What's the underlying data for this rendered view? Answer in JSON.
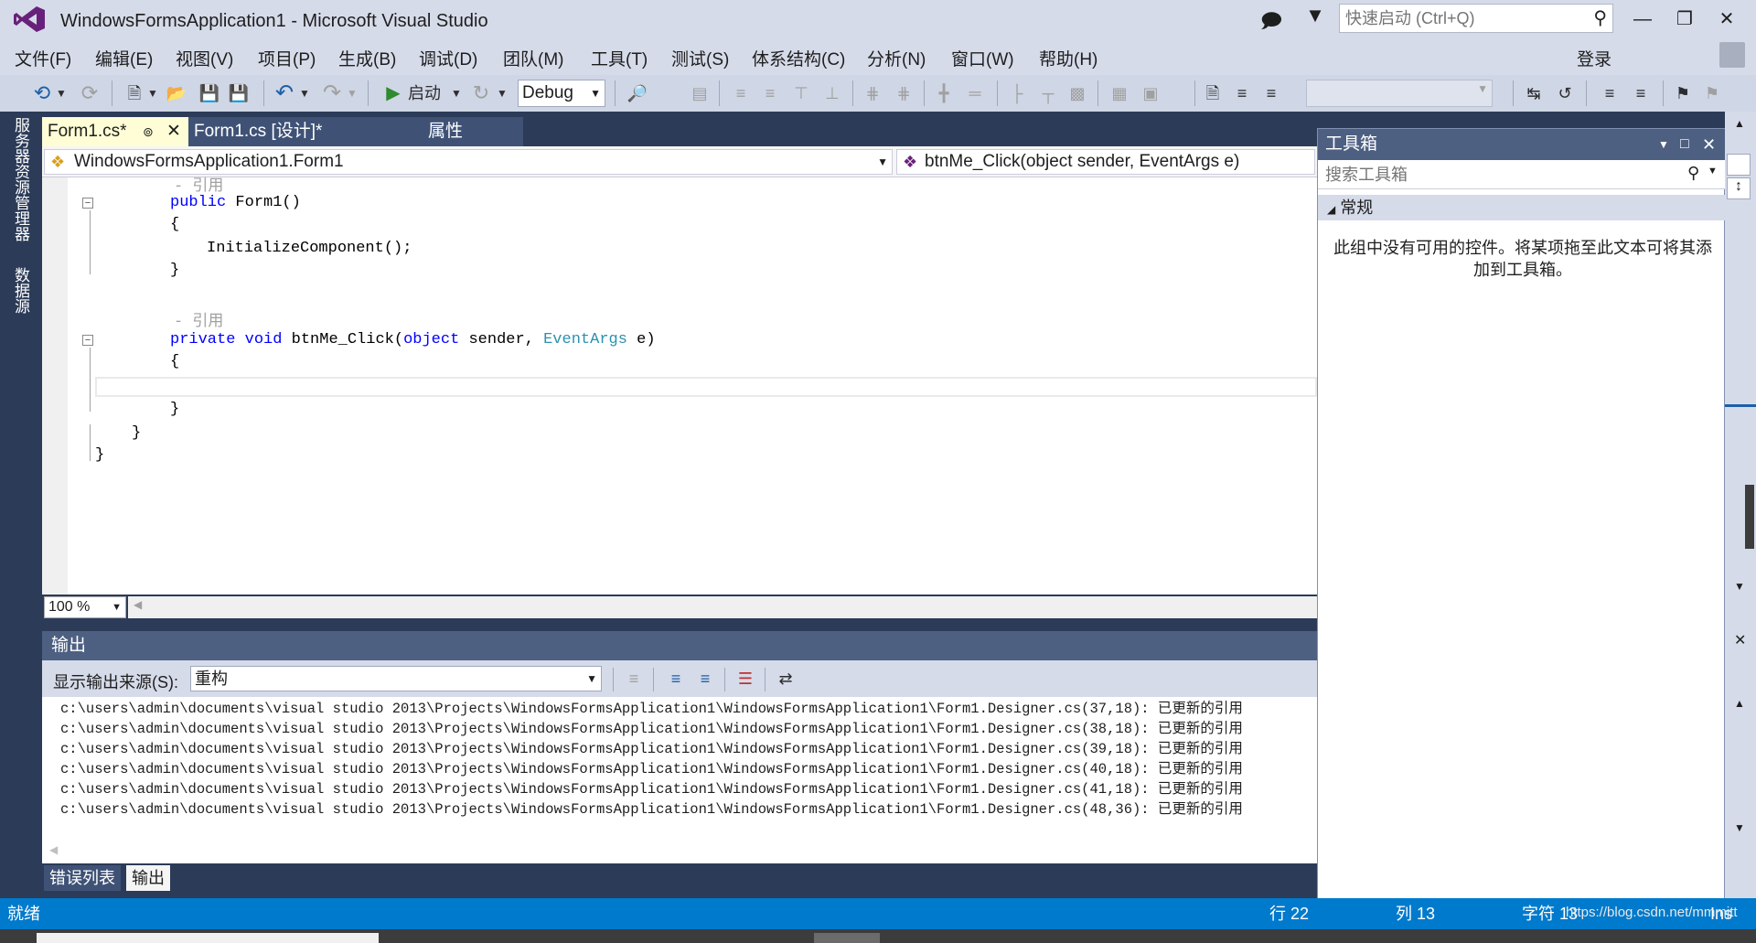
{
  "window": {
    "title": "WindowsFormsApplication1 - Microsoft Visual Studio",
    "quick_launch_placeholder": "快速启动 (Ctrl+Q)"
  },
  "menu": {
    "items": [
      "文件(F)",
      "编辑(E)",
      "视图(V)",
      "项目(P)",
      "生成(B)",
      "调试(D)",
      "团队(M)",
      "工具(T)",
      "测试(S)",
      "体系结构(C)",
      "分析(N)",
      "窗口(W)",
      "帮助(H)"
    ],
    "login": "登录"
  },
  "toolbar": {
    "start_label": "启动",
    "config": "Debug"
  },
  "side_tabs": [
    "服务器资源管理器",
    "数据源"
  ],
  "doc_tabs": [
    "Form1.cs*",
    "Form1.cs [设计]*",
    "属性"
  ],
  "nav": {
    "class": "WindowsFormsApplication1.Form1",
    "member": "btnMe_Click(object sender, EventArgs e)"
  },
  "code": {
    "ref1": "- 引用",
    "ctor": [
      "public",
      " Form1()"
    ],
    "open_brace": "{",
    "init": "InitializeComponent();",
    "close_brace": "}",
    "ref2": "- 引用",
    "method": [
      "private",
      " ",
      "void",
      " btnMe_Click(",
      "object",
      " sender, ",
      "EventArgs",
      " e)"
    ],
    "class_close": "}",
    "ns_close": "}"
  },
  "editor": {
    "zoom": "100 %"
  },
  "output": {
    "title": "输出",
    "source_label": "显示输出来源(S):",
    "source_value": "重构",
    "lines": [
      "c:\\users\\admin\\documents\\visual studio 2013\\Projects\\WindowsFormsApplication1\\WindowsFormsApplication1\\Form1.Designer.cs(37,18): 已更新的引用",
      "c:\\users\\admin\\documents\\visual studio 2013\\Projects\\WindowsFormsApplication1\\WindowsFormsApplication1\\Form1.Designer.cs(38,18): 已更新的引用",
      "c:\\users\\admin\\documents\\visual studio 2013\\Projects\\WindowsFormsApplication1\\WindowsFormsApplication1\\Form1.Designer.cs(39,18): 已更新的引用",
      "c:\\users\\admin\\documents\\visual studio 2013\\Projects\\WindowsFormsApplication1\\WindowsFormsApplication1\\Form1.Designer.cs(40,18): 已更新的引用",
      "c:\\users\\admin\\documents\\visual studio 2013\\Projects\\WindowsFormsApplication1\\WindowsFormsApplication1\\Form1.Designer.cs(41,18): 已更新的引用",
      "c:\\users\\admin\\documents\\visual studio 2013\\Projects\\WindowsFormsApplication1\\WindowsFormsApplication1\\Form1.Designer.cs(48,36): 已更新的引用"
    ],
    "tabs": [
      "错误列表",
      "输出"
    ]
  },
  "toolbox": {
    "title": "工具箱",
    "search_placeholder": "搜索工具箱",
    "group": "常规",
    "empty_text": "此组中没有可用的控件。将某项拖至此文本可将其添加到工具箱。"
  },
  "status": {
    "ready": "就绪",
    "line": "行 22",
    "col": "列 13",
    "ch": "字符 13",
    "mode": "Ins",
    "watermark": "https://blog.csdn.net/mmmjtt"
  },
  "colors": {
    "accent": "#007acc",
    "chrome": "#d6dbe9",
    "panel_header": "#4d6082",
    "keyword": "#0000ff",
    "type": "#2b91af"
  }
}
